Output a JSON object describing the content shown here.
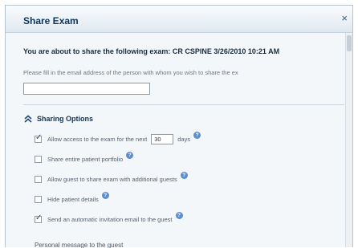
{
  "dialog": {
    "title": "Share Exam",
    "close": "×"
  },
  "headline": "You are about to share the following exam: CR CSPINE 3/26/2010 10:21 AM",
  "instructions": "Please fill in the email address of the person with whom you wish to share the ex",
  "email": {
    "value": ""
  },
  "sharing": {
    "title": "Sharing Options",
    "access": {
      "before": "Allow access to the exam for the next",
      "days_value": "30",
      "after": "days",
      "checked": true
    },
    "portfolio": {
      "label": "Share entire patient portfolio",
      "checked": false
    },
    "guests": {
      "label": "Allow guest to share exam with additional guests",
      "checked": false
    },
    "hide": {
      "label": "Hide patient details",
      "checked": false
    },
    "invite": {
      "label": "Send an automatic invitation email to the guest",
      "checked": true
    }
  },
  "help_glyph": "?",
  "personal_message_label": "Personal message to the guest"
}
